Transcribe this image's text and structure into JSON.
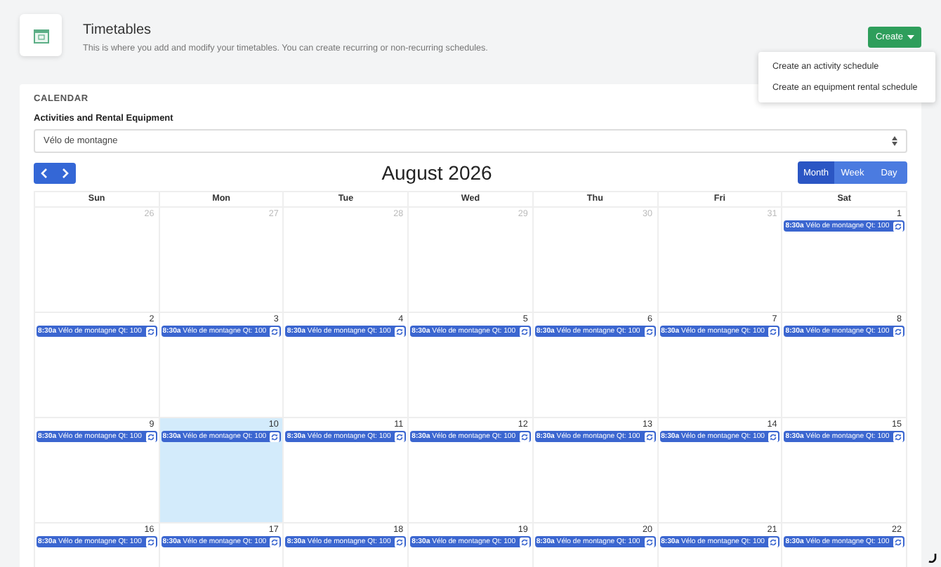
{
  "header": {
    "title": "Timetables",
    "subtitle": "This is where you add and modify your timetables. You can create recurring or non-recurring schedules.",
    "create_button": "Create",
    "menu": [
      "Create an activity schedule",
      "Create an equipment rental schedule"
    ]
  },
  "calendar": {
    "section_title": "CALENDAR",
    "field_label": "Activities and Rental Equipment",
    "select_value": "Vélo de montagne",
    "month_title": "August 2026",
    "views": [
      {
        "label": "Month",
        "selected": true
      },
      {
        "label": "Week",
        "selected": false
      },
      {
        "label": "Day",
        "selected": false
      }
    ],
    "weekdays": [
      "Sun",
      "Mon",
      "Tue",
      "Wed",
      "Thu",
      "Fri",
      "Sat"
    ],
    "weeks": [
      [
        {
          "day": "26",
          "muted": true,
          "today": false
        },
        {
          "day": "27",
          "muted": true,
          "today": false
        },
        {
          "day": "28",
          "muted": true,
          "today": false
        },
        {
          "day": "29",
          "muted": true,
          "today": false
        },
        {
          "day": "30",
          "muted": true,
          "today": false
        },
        {
          "day": "31",
          "muted": true,
          "today": false
        },
        {
          "day": "1",
          "muted": false,
          "today": false,
          "events": [
            {
              "time": "8:30a",
              "title": "Vélo de montagne Qt: 100"
            }
          ]
        }
      ],
      [
        {
          "day": "2",
          "muted": false,
          "today": false,
          "events": [
            {
              "time": "8:30a",
              "title": "Vélo de montagne Qt: 100"
            }
          ]
        },
        {
          "day": "3",
          "muted": false,
          "today": false,
          "events": [
            {
              "time": "8:30a",
              "title": "Vélo de montagne Qt: 100"
            }
          ]
        },
        {
          "day": "4",
          "muted": false,
          "today": false,
          "events": [
            {
              "time": "8:30a",
              "title": "Vélo de montagne Qt: 100"
            }
          ]
        },
        {
          "day": "5",
          "muted": false,
          "today": false,
          "events": [
            {
              "time": "8:30a",
              "title": "Vélo de montagne Qt: 100"
            }
          ]
        },
        {
          "day": "6",
          "muted": false,
          "today": false,
          "events": [
            {
              "time": "8:30a",
              "title": "Vélo de montagne Qt: 100"
            }
          ]
        },
        {
          "day": "7",
          "muted": false,
          "today": false,
          "events": [
            {
              "time": "8:30a",
              "title": "Vélo de montagne Qt: 100"
            }
          ]
        },
        {
          "day": "8",
          "muted": false,
          "today": false,
          "events": [
            {
              "time": "8:30a",
              "title": "Vélo de montagne Qt: 100"
            }
          ]
        }
      ],
      [
        {
          "day": "9",
          "muted": false,
          "today": false,
          "events": [
            {
              "time": "8:30a",
              "title": "Vélo de montagne Qt: 100"
            }
          ]
        },
        {
          "day": "10",
          "muted": false,
          "today": true,
          "events": [
            {
              "time": "8:30a",
              "title": "Vélo de montagne Qt: 100"
            }
          ]
        },
        {
          "day": "11",
          "muted": false,
          "today": false,
          "events": [
            {
              "time": "8:30a",
              "title": "Vélo de montagne Qt: 100"
            }
          ]
        },
        {
          "day": "12",
          "muted": false,
          "today": false,
          "events": [
            {
              "time": "8:30a",
              "title": "Vélo de montagne Qt: 100"
            }
          ]
        },
        {
          "day": "13",
          "muted": false,
          "today": false,
          "events": [
            {
              "time": "8:30a",
              "title": "Vélo de montagne Qt: 100"
            }
          ]
        },
        {
          "day": "14",
          "muted": false,
          "today": false,
          "events": [
            {
              "time": "8:30a",
              "title": "Vélo de montagne Qt: 100"
            }
          ]
        },
        {
          "day": "15",
          "muted": false,
          "today": false,
          "events": [
            {
              "time": "8:30a",
              "title": "Vélo de montagne Qt: 100"
            }
          ]
        }
      ],
      [
        {
          "day": "16",
          "muted": false,
          "today": false,
          "events": [
            {
              "time": "8:30a",
              "title": "Vélo de montagne Qt: 100"
            }
          ]
        },
        {
          "day": "17",
          "muted": false,
          "today": false,
          "events": [
            {
              "time": "8:30a",
              "title": "Vélo de montagne Qt: 100"
            }
          ]
        },
        {
          "day": "18",
          "muted": false,
          "today": false,
          "events": [
            {
              "time": "8:30a",
              "title": "Vélo de montagne Qt: 100"
            }
          ]
        },
        {
          "day": "19",
          "muted": false,
          "today": false,
          "events": [
            {
              "time": "8:30a",
              "title": "Vélo de montagne Qt: 100"
            }
          ]
        },
        {
          "day": "20",
          "muted": false,
          "today": false,
          "events": [
            {
              "time": "8:30a",
              "title": "Vélo de montagne Qt: 100"
            }
          ]
        },
        {
          "day": "21",
          "muted": false,
          "today": false,
          "events": [
            {
              "time": "8:30a",
              "title": "Vélo de montagne Qt: 100"
            }
          ]
        },
        {
          "day": "22",
          "muted": false,
          "today": false,
          "events": [
            {
              "time": "8:30a",
              "title": "Vélo de montagne Qt: 100"
            }
          ]
        }
      ]
    ]
  }
}
